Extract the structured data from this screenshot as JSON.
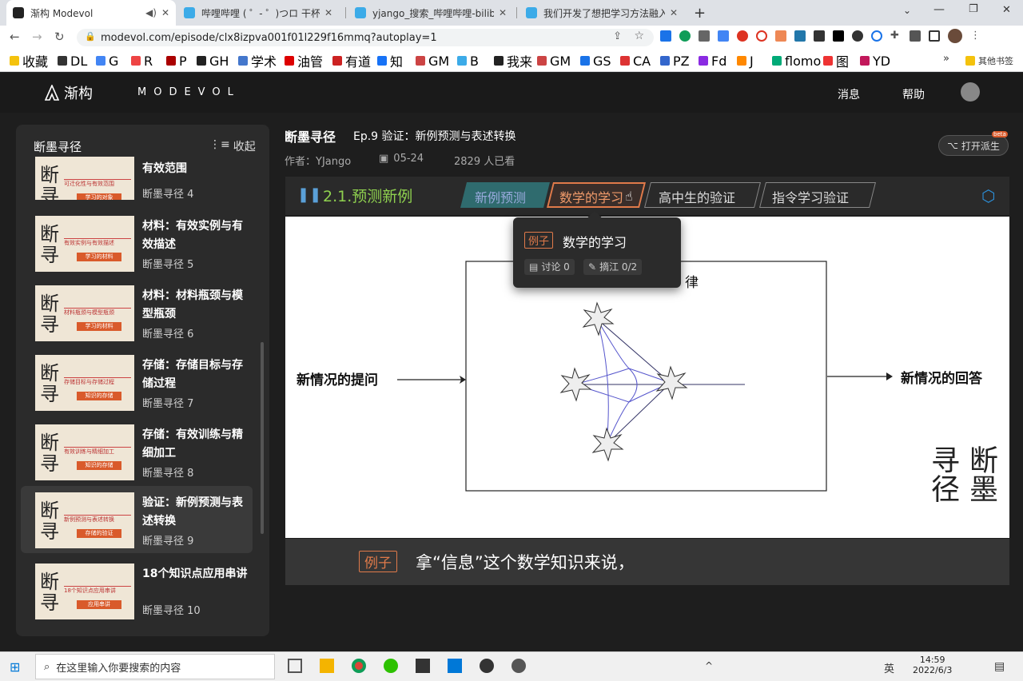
{
  "browser": {
    "tabs": [
      {
        "title": "渐构 Modevol",
        "active": true
      },
      {
        "title": "哔哩哔哩 ( ゜- ゜)つロ 干杯~-bili",
        "active": false
      },
      {
        "title": "yjango_搜索_哔哩哔哩-bilibili",
        "active": false
      },
      {
        "title": "我们开发了想把学习方法融入播放",
        "active": false
      }
    ],
    "new_tab": "+",
    "url": "modevol.com/episode/clx8izpva001f01l229f16mmq?autoplay=1",
    "bookmarks": [
      "收藏",
      "DL",
      "G",
      "R",
      "P",
      "GH",
      "学术",
      "油管",
      "有道",
      "知",
      "GM",
      "B",
      "我来",
      "GM",
      "GS",
      "CA",
      "PZ",
      "Fd",
      "J",
      "flomo",
      "图",
      "YD"
    ],
    "other_bookmarks": "其他书签",
    "more": "»"
  },
  "site": {
    "logo": "渐构",
    "brand": "MODEVOL",
    "nav": [
      "消息",
      "帮助"
    ],
    "sidebar_title": "断墨寻径",
    "collapse": "收起",
    "episodes": [
      {
        "title": "有效范围",
        "series": "断墨寻径 4",
        "thumb_title": "可迁化性与有效范围",
        "thumb_btn": "学习的对象"
      },
      {
        "title": "材料：有效实例与有效描述",
        "series": "断墨寻径 5",
        "thumb_title": "有效实例与有效描述",
        "thumb_btn": "学习的材料"
      },
      {
        "title": "材料：材料瓶颈与模型瓶颈",
        "series": "断墨寻径 6",
        "thumb_title": "材料瓶颈与模型瓶颈",
        "thumb_btn": "学习的材料"
      },
      {
        "title": "存储：存储目标与存储过程",
        "series": "断墨寻径 7",
        "thumb_title": "存储目标与存储过程",
        "thumb_btn": "知识的存储"
      },
      {
        "title": "存储：有效训练与精细加工",
        "series": "断墨寻径 8",
        "thumb_title": "有效训练与精细加工",
        "thumb_btn": "知识的存储"
      },
      {
        "title": "验证：新例预测与表述转换",
        "series": "断墨寻径 9",
        "thumb_title": "新例预测与表述转换",
        "thumb_btn": "存储的验证",
        "selected": true
      },
      {
        "title": "18个知识点应用串讲",
        "series": "断墨寻径 10",
        "thumb_title": "18个知识点应用串讲",
        "thumb_btn": "应用串讲"
      }
    ],
    "episode": {
      "series": "断墨寻径",
      "title": "Ep.9 验证：新例预测与表述转换",
      "author": "作者：YJango",
      "date": "05-24",
      "viewers": "2829 人已看",
      "open_btn": "打开派生",
      "beta": "beta"
    },
    "player": {
      "section": "2.1.预测新例",
      "chapters": [
        "新例预测",
        "数学的学习",
        "高中生的验证",
        "指令学习验证"
      ],
      "tooltip": {
        "tag": "例子",
        "title": "数学的学习",
        "discuss": "讨论 0",
        "excerpt": "摘江 0/2"
      },
      "diagram": {
        "left": "新情况的提问",
        "right": "新情况的回答",
        "partial": "律"
      },
      "watermark": "断墨寻径",
      "subtitle_tag": "例子",
      "subtitle": "拿“信息”这个数学知识来说，"
    }
  },
  "taskbar": {
    "search": "在这里输入你要搜索的内容",
    "time": "14:59",
    "date": "2022/6/3",
    "ime": "英"
  }
}
